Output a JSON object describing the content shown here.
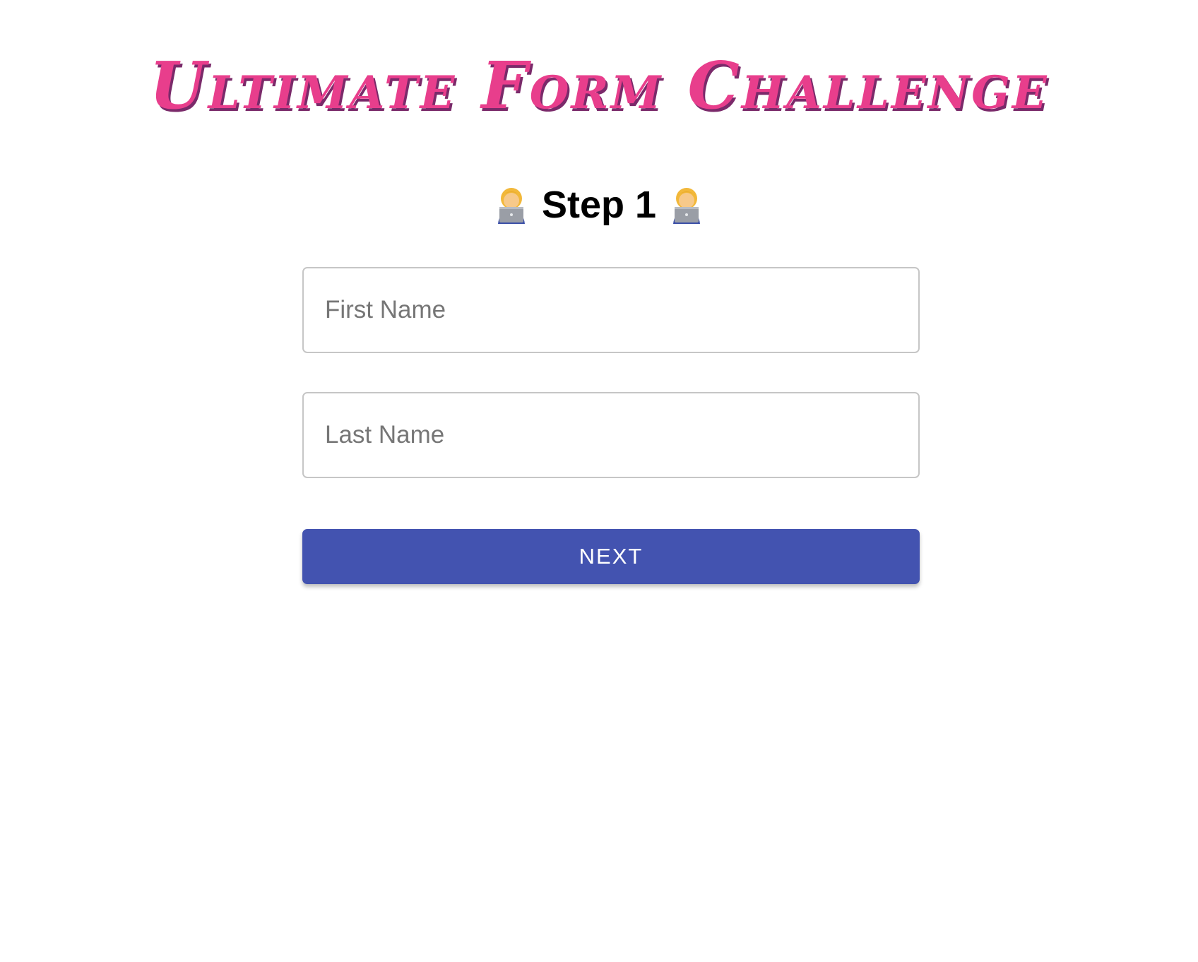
{
  "header": {
    "title": "Ultimate Form Challenge"
  },
  "step": {
    "label": "Step 1",
    "icon": "woman-technologist-icon"
  },
  "form": {
    "first_name": {
      "value": "",
      "placeholder": "First Name"
    },
    "last_name": {
      "value": "",
      "placeholder": "Last Name"
    },
    "next_label": "NEXT"
  },
  "colors": {
    "title": "#e83e8c",
    "title_shadow": "#7a2a6a",
    "button": "#4353b0",
    "input_border": "#c6c6c6",
    "placeholder": "#767676"
  }
}
